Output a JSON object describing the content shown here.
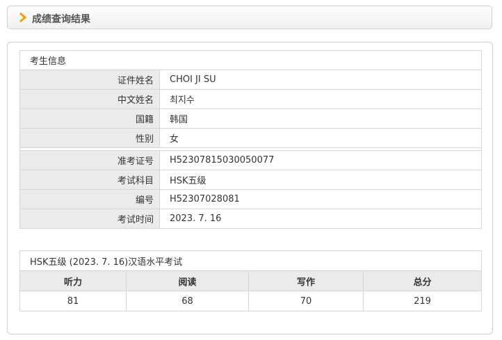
{
  "header": {
    "title": "成绩查询结果"
  },
  "candient": {
    "section_title": "考生信息",
    "rows_personal": [
      {
        "label": "证件姓名",
        "value": "CHOI JI SU"
      },
      {
        "label": "中文姓名",
        "value": "최지수"
      },
      {
        "label": "国籍",
        "value": "韩国"
      },
      {
        "label": "性别",
        "value": "女"
      }
    ],
    "rows_exam": [
      {
        "label": "准考证号",
        "value": "H52307815030050077"
      },
      {
        "label": "考试科目",
        "value": "HSK五级"
      },
      {
        "label": "编号",
        "value": "H52307028081"
      },
      {
        "label": "考试时间",
        "value": "2023. 7. 16"
      }
    ]
  },
  "scores": {
    "title": "HSK五级 (2023. 7. 16)汉语水平考试",
    "columns": [
      "听力",
      "阅读",
      "写作",
      "总分"
    ],
    "values": [
      "81",
      "68",
      "70",
      "219"
    ]
  }
}
